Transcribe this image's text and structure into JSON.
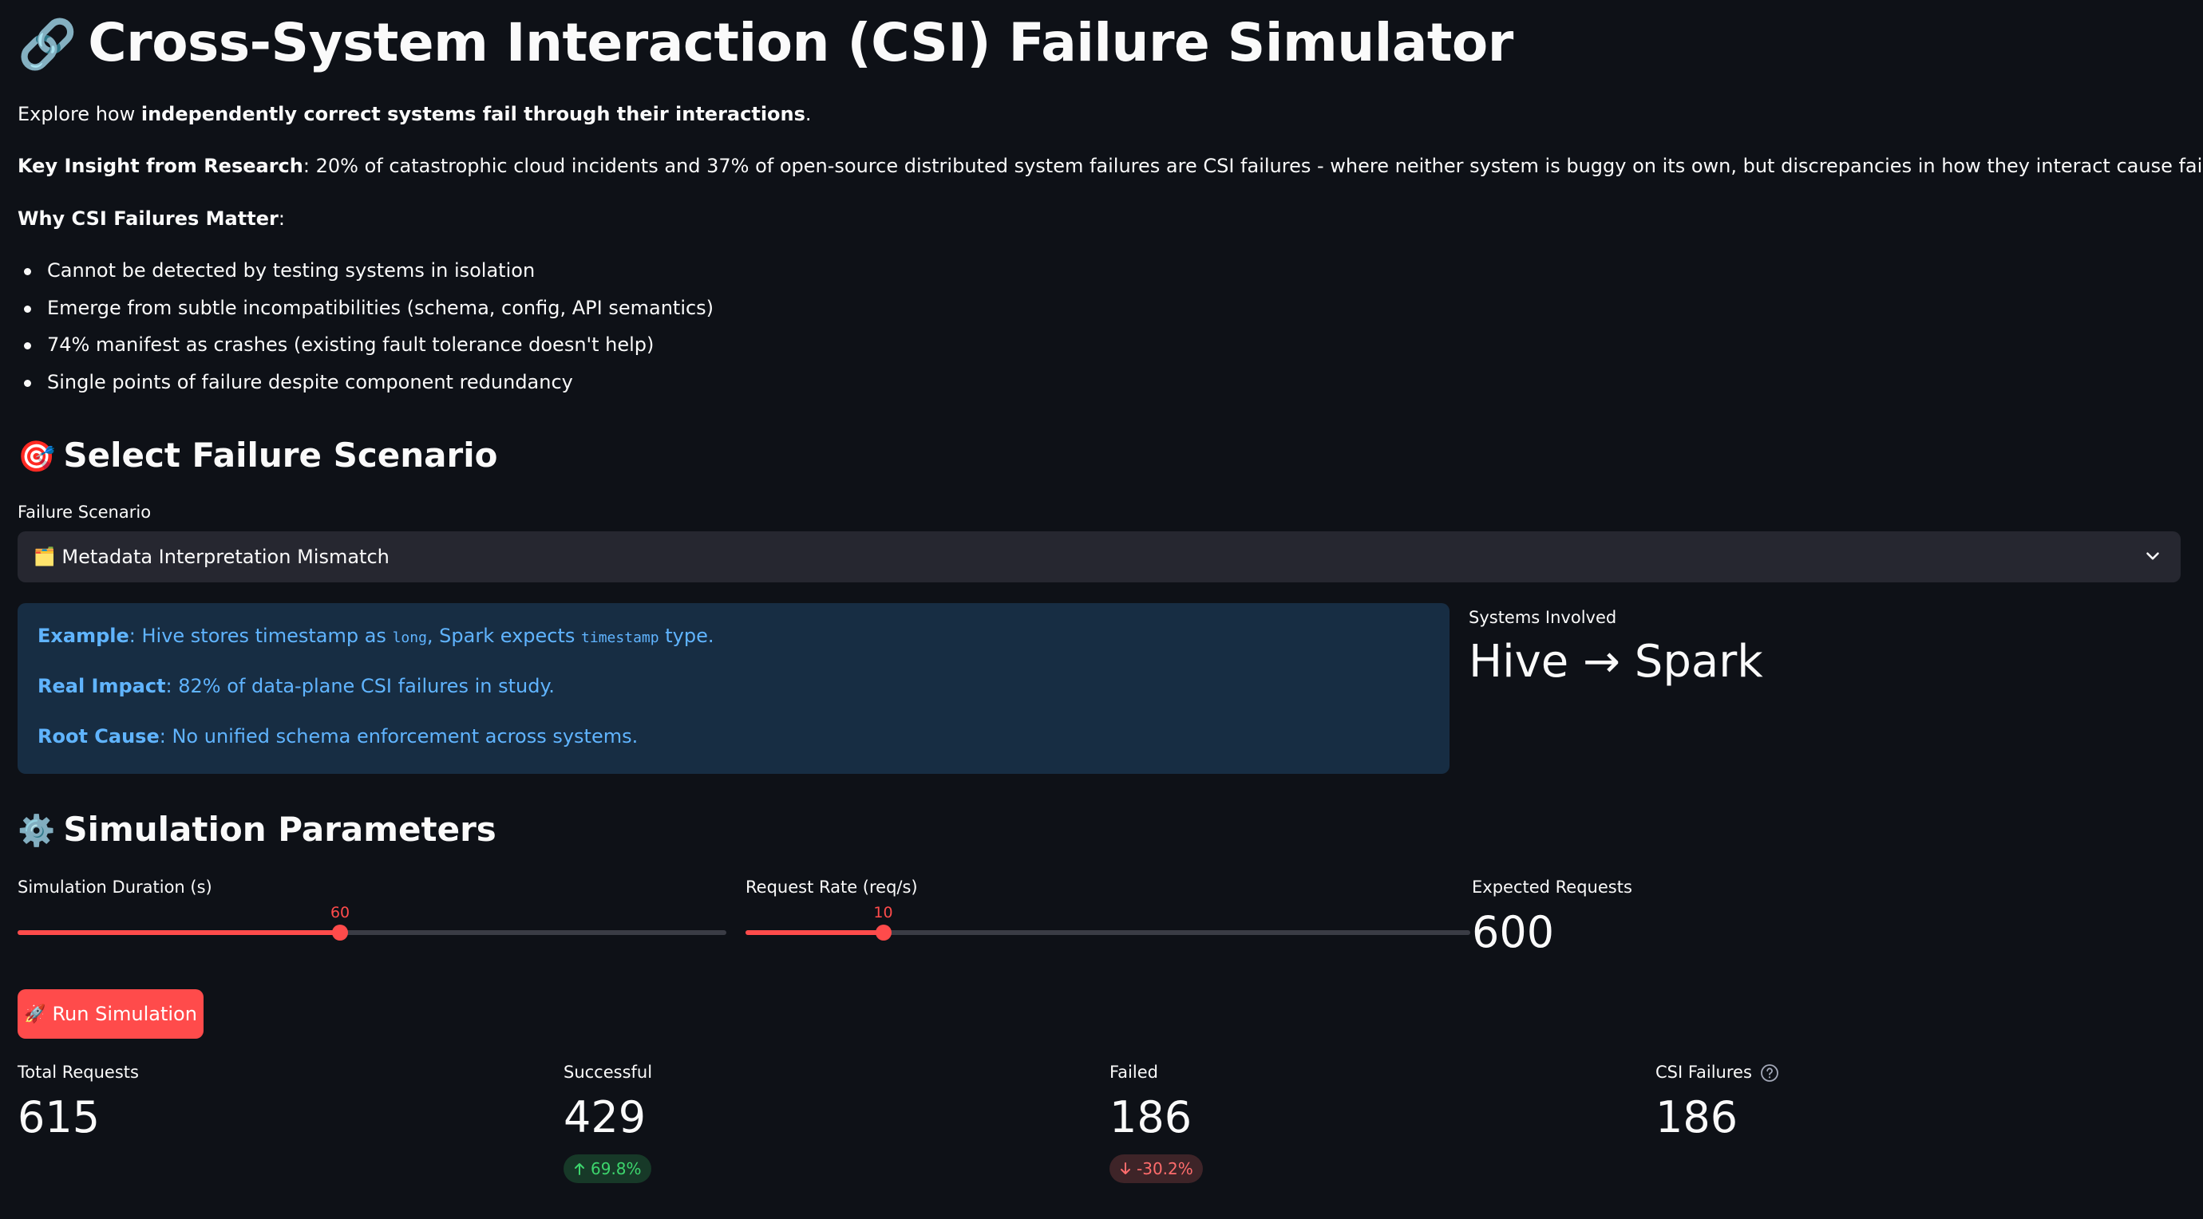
{
  "header": {
    "title_emoji": "🔗",
    "title": "Cross-System Interaction (CSI) Failure Simulator"
  },
  "intro": {
    "explore_prefix": "Explore how ",
    "explore_bold": "independently correct systems fail through their interactions",
    "explore_suffix": ".",
    "insight_bold": "Key Insight from Research",
    "insight_text": ": 20% of catastrophic cloud incidents and 37% of open-source distributed system failures are CSI failures - where neither system is buggy on its own, but discrepancies in how they interact cause failures.",
    "why_bold": "Why CSI Failures Matter",
    "why_suffix": ":"
  },
  "bullets": [
    "Cannot be detected by testing systems in isolation",
    "Emerge from subtle incompatibilities (schema, config, API semantics)",
    "74% manifest as crashes (existing fault tolerance doesn't help)",
    "Single points of failure despite component redundancy"
  ],
  "scenario_section": {
    "emoji": "🎯",
    "heading": "Select Failure Scenario",
    "select_label": "Failure Scenario",
    "selected_emoji": "🗂️",
    "selected_value": "Metadata Interpretation Mismatch"
  },
  "scenario_info": {
    "example_bold": "Example",
    "example_text_1": ": Hive stores timestamp as ",
    "example_code_1": "long",
    "example_text_2": ", Spark expects ",
    "example_code_2": "timestamp",
    "example_text_3": " type.",
    "impact_bold": "Real Impact",
    "impact_text": ": 82% of data-plane CSI failures in study.",
    "cause_bold": "Root Cause",
    "cause_text": ": No unified schema enforcement across systems."
  },
  "systems": {
    "label": "Systems Involved",
    "value": "Hive → Spark"
  },
  "params_section": {
    "emoji": "⚙️",
    "heading": "Simulation Parameters",
    "duration_label": "Simulation Duration (s)",
    "duration_value": "60",
    "duration_fraction": 0.455,
    "rate_label": "Request Rate (req/s)",
    "rate_value": "10",
    "rate_fraction": 0.19,
    "expected_label": "Expected Requests",
    "expected_value": "600"
  },
  "run_button": {
    "emoji": "🚀",
    "label": "Run Simulation"
  },
  "results": {
    "total_label": "Total Requests",
    "total_value": "615",
    "success_label": "Successful",
    "success_value": "429",
    "success_delta": "69.8%",
    "failed_label": "Failed",
    "failed_value": "186",
    "failed_delta": "-30.2%",
    "csi_label": "CSI Failures",
    "csi_value": "186"
  },
  "colors": {
    "background": "#0e1117",
    "accent": "#ff4b4b",
    "info_bg": "#172d43",
    "info_text": "#60b4ff",
    "delta_up": "#3dd56d",
    "delta_down": "#ff6c6c"
  }
}
